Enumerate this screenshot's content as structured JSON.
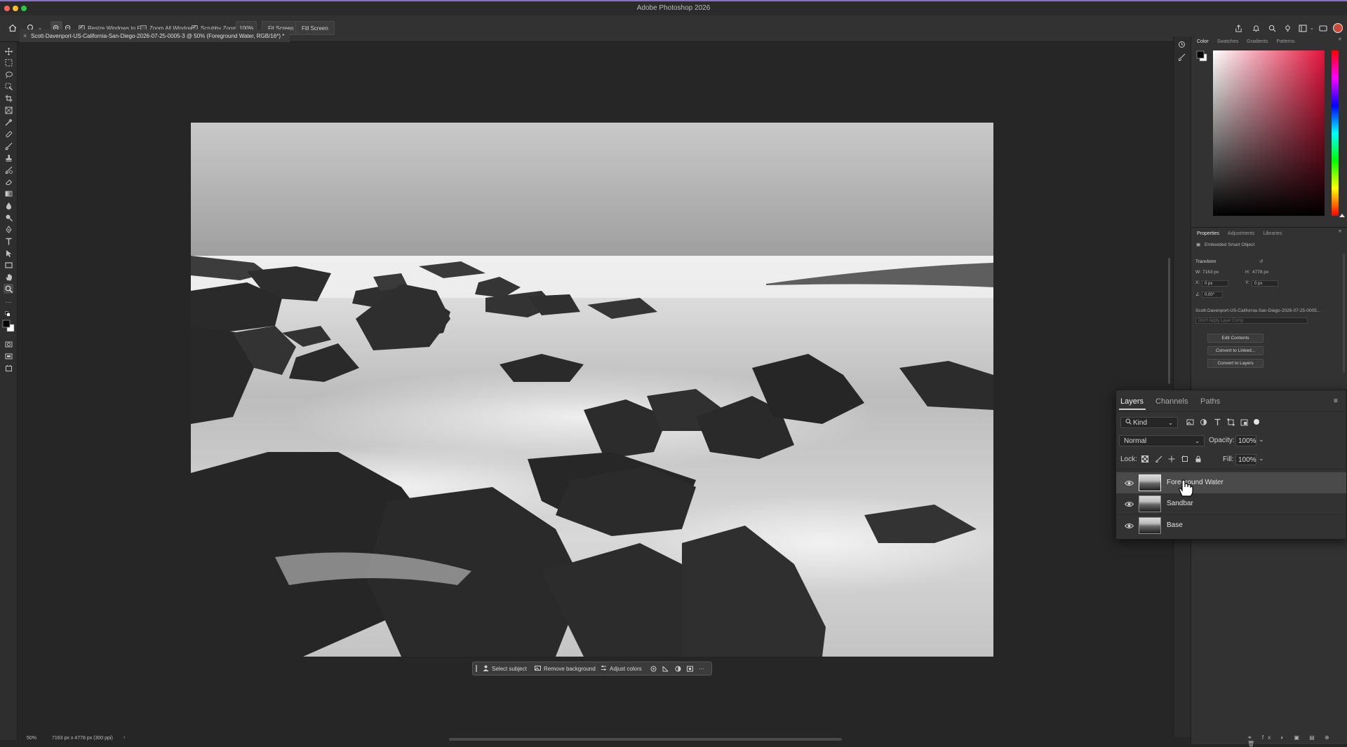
{
  "app": {
    "title": "Adobe Photoshop 2026",
    "traffic_light_colors": [
      "#fe5f57",
      "#febc2e",
      "#28c840"
    ]
  },
  "options_bar": {
    "tool_icon": "zoom-icon",
    "resize_windows": {
      "label": "Resize Windows to Fit",
      "checked": true
    },
    "zoom_all": {
      "label": "Zoom All Windows",
      "checked": false
    },
    "scrubby": {
      "label": "Scrubby Zoom",
      "checked": true
    },
    "zoom_value": "100%",
    "fit_screen": "Fit Screen",
    "fill_screen": "Fill Screen"
  },
  "document": {
    "tab_title": "Scott-Davenport-US-California-San-Diego-2026-07-25-0005-3 @ 50% (Foreground Water, RGB/16*) *",
    "close_glyph": "×"
  },
  "contextual_bar": {
    "select_subject": "Select subject",
    "remove_background": "Remove background",
    "adjust_colors": "Adjust colors",
    "more": "···"
  },
  "status_bar": {
    "zoom": "50%",
    "doc_info": "7163 px x 4778 px (300 ppi)",
    "arrow": "›"
  },
  "color_panel": {
    "tabs": [
      "Color",
      "Swatches",
      "Gradients",
      "Patterns"
    ],
    "active_tab": "Color",
    "hue_color": "#e4143c"
  },
  "properties_panel": {
    "tabs": [
      "Properties",
      "Adjustments",
      "Libraries"
    ],
    "object_type": "Embedded Smart Object",
    "transform_label": "Transform",
    "w_label": "W:",
    "w_value": "7163 px",
    "h_label": "H:",
    "h_value": "4778 px",
    "x_label": "X:",
    "x_value": "0 px",
    "y_label": "Y:",
    "y_value": "0 px",
    "angle": "0.00°",
    "filename": "Scott-Davenport-US-California-San-Diego-2026-07-25-0005...",
    "layer_comp": "Don't Apply Layer Comp",
    "edit_contents": "Edit Contents",
    "convert_linked": "Convert to Linked...",
    "convert_layers": "Convert to Layers"
  },
  "layers_panel": {
    "tabs": [
      "Layers",
      "Channels",
      "Paths"
    ],
    "active_tab": "Layers",
    "filter_kind": "Kind",
    "blend_mode": "Normal",
    "opacity_label": "Opacity:",
    "opacity_value": "100%",
    "lock_label": "Lock:",
    "fill_label": "Fill:",
    "fill_value": "100%",
    "layers": [
      {
        "name": "Foreground Water",
        "selected": true,
        "visible": true
      },
      {
        "name": "Sandbar",
        "selected": false,
        "visible": true
      },
      {
        "name": "Base",
        "selected": false,
        "visible": true
      }
    ]
  }
}
